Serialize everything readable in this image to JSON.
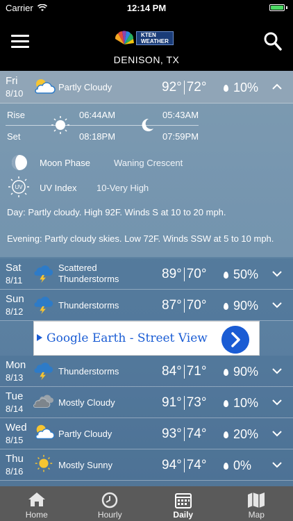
{
  "status": {
    "carrier": "Carrier",
    "time": "12:14 PM"
  },
  "header": {
    "location": "DENISON, TX",
    "logo_line1": "KTEN",
    "logo_line2": "WEATHER"
  },
  "expanded_day": {
    "day": "Fri",
    "date": "8/10",
    "condition": "Partly Cloudy",
    "high": "92°",
    "low": "72°",
    "precip": "10%",
    "rise_label": "Rise",
    "set_label": "Set",
    "sunrise": "06:44AM",
    "sunset": "08:18PM",
    "moonrise": "05:43AM",
    "moonset": "07:59PM",
    "moon_phase_label": "Moon Phase",
    "moon_phase_value": "Waning Crescent",
    "uv_label": "UV Index",
    "uv_value": "10-Very High",
    "day_label": "Day",
    "day_text": ": Partly cloudy. High 92F. Winds S at 10 to 20 mph.",
    "evening_label": "Evening",
    "evening_text": ": Partly cloudy skies. Low 72F. Winds SSW at 5 to 10 mph."
  },
  "days": [
    {
      "day": "Sat",
      "date": "8/11",
      "condition": "Scattered Thunderstorms",
      "high": "89°",
      "low": "70°",
      "precip": "50%",
      "icon": "thunderstorm-icon"
    },
    {
      "day": "Sun",
      "date": "8/12",
      "condition": "Thunderstorms",
      "high": "87°",
      "low": "70°",
      "precip": "90%",
      "icon": "thunderstorm-icon"
    },
    {
      "day": "Mon",
      "date": "8/13",
      "condition": "Thunderstorms",
      "high": "84°",
      "low": "71°",
      "precip": "90%",
      "icon": "thunderstorm-icon"
    },
    {
      "day": "Tue",
      "date": "8/14",
      "condition": "Mostly Cloudy",
      "high": "91°",
      "low": "73°",
      "precip": "10%",
      "icon": "cloudy-icon"
    },
    {
      "day": "Wed",
      "date": "8/15",
      "condition": "Partly Cloudy",
      "high": "93°",
      "low": "74°",
      "precip": "20%",
      "icon": "partly-cloudy-icon"
    },
    {
      "day": "Thu",
      "date": "8/16",
      "condition": "Mostly Sunny",
      "high": "94°",
      "low": "74°",
      "precip": "0%",
      "icon": "sunny-icon"
    }
  ],
  "ad": {
    "text": "Google Earth - Street View"
  },
  "tabs": [
    {
      "label": "Home",
      "icon": "home-icon"
    },
    {
      "label": "Hourly",
      "icon": "clock-icon"
    },
    {
      "label": "Daily",
      "icon": "calendar-icon"
    },
    {
      "label": "Map",
      "icon": "map-icon"
    }
  ],
  "colors": {
    "ad_blue": "#1a5cd4",
    "battery_green": "#4cd964",
    "tabbar": "#5a5a5a"
  }
}
